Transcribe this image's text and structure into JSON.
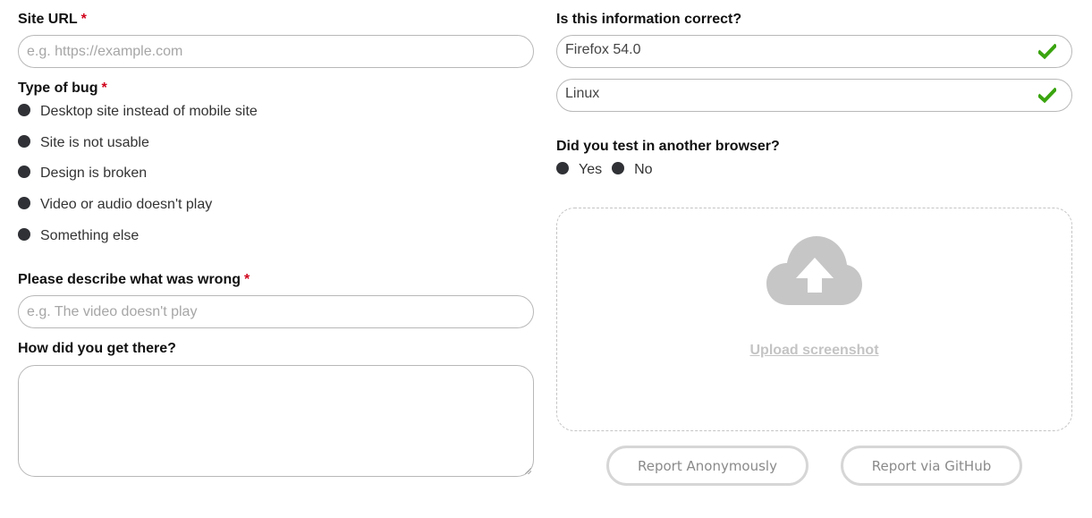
{
  "site_url": {
    "label": "Site URL",
    "required_mark": "*",
    "placeholder": "e.g. https://example.com"
  },
  "bug_type": {
    "label": "Type of bug",
    "required_mark": "*",
    "options": [
      "Desktop site instead of mobile site",
      "Site is not usable",
      "Design is broken",
      "Video or audio doesn't play",
      "Something else"
    ]
  },
  "description": {
    "label": "Please describe what was wrong",
    "required_mark": "*",
    "placeholder": "e.g. The video doesn't play"
  },
  "steps": {
    "label": "How did you get there?",
    "value": ""
  },
  "info_check": {
    "label": "Is this information correct?",
    "browser": "Firefox 54.0",
    "os": "Linux",
    "check_color": "#3aa40f"
  },
  "other_browser": {
    "label": "Did you test in another browser?",
    "options": [
      "Yes",
      "No"
    ]
  },
  "upload": {
    "link_label": "Upload screenshot",
    "icon": "cloud-upload-icon",
    "icon_color": "#c6c6c6"
  },
  "actions": {
    "anonymous_label": "Report Anonymously",
    "github_label": "Report via GitHub"
  },
  "colors": {
    "required": "#d0021b",
    "radio": "#2f3136",
    "border": "#b8b8b8"
  }
}
